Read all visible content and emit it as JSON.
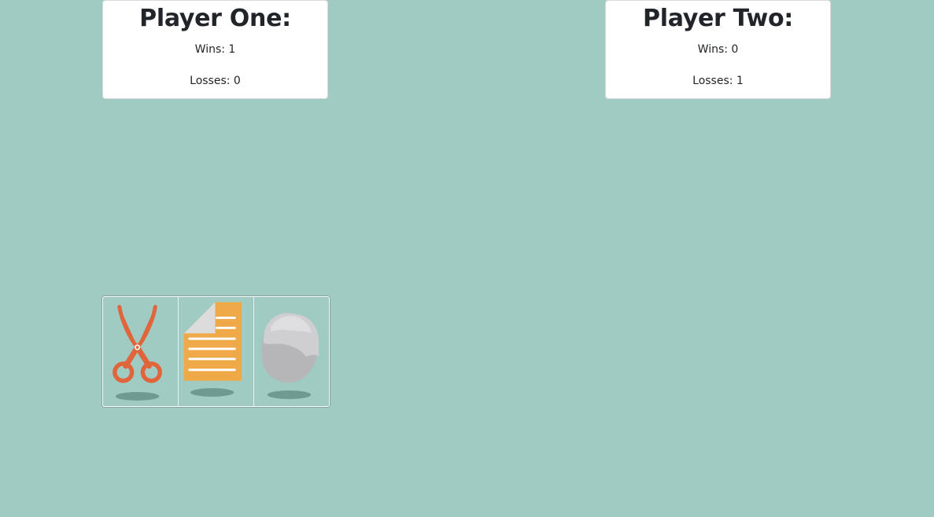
{
  "players": [
    {
      "title": "Player One:",
      "wins": "Wins: 1",
      "losses": "Losses: 0"
    },
    {
      "title": "Player Two:",
      "wins": "Wins: 0",
      "losses": "Losses: 1"
    }
  ],
  "choices": [
    {
      "icon": "scissors-icon",
      "color": "#e0653a"
    },
    {
      "icon": "paper-icon",
      "color": "#f0a948"
    },
    {
      "icon": "rock-icon",
      "color": "#bdbdbd"
    }
  ],
  "colors": {
    "background": "#9fcbc2",
    "card": "#ffffff",
    "text": "#212529",
    "shadow": "#6f9a92"
  }
}
